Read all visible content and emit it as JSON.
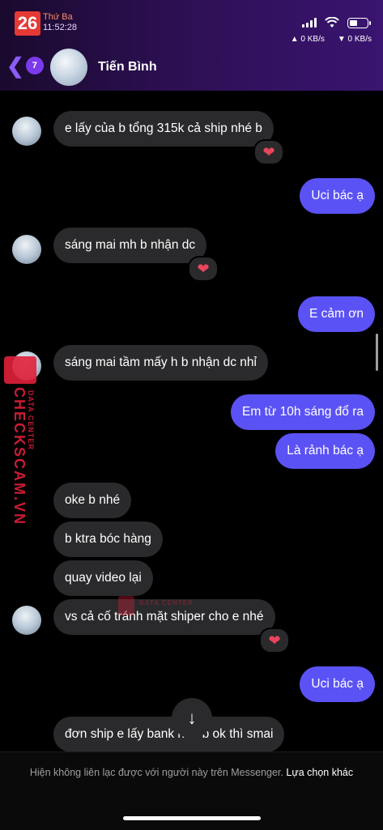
{
  "status_bar": {
    "date_number": "26",
    "weekday": "Thứ Ba",
    "time": "11:52:28",
    "upload_speed": "▲ 0 KB/s",
    "download_speed": "▼ 0 KB/s",
    "battery_level": 0.45
  },
  "header": {
    "unread_count": "7",
    "contact_name": "Tiến Bình"
  },
  "messages": [
    {
      "from": "them",
      "text": "e lấy của b tổng 315k cả ship nhé b",
      "reaction": "heart"
    },
    {
      "from": "me",
      "text": "Uci bác ạ"
    },
    {
      "from": "them",
      "text": "sáng mai mh b nhận dc",
      "reaction": "heart"
    },
    {
      "from": "me",
      "text": "E cảm ơn"
    },
    {
      "from": "them",
      "text": "sáng mai tầm mấy h b nhận dc nhỉ"
    },
    {
      "from": "me",
      "text": "Em từ 10h sáng đổ ra"
    },
    {
      "from": "me",
      "text": "Là rảnh bác ạ"
    },
    {
      "from": "them",
      "text": "oke b nhé"
    },
    {
      "from": "them",
      "text": "b ktra bóc hàng"
    },
    {
      "from": "them",
      "text": "quay video lại"
    },
    {
      "from": "them",
      "text": "vs cả cố tránh mặt shiper cho e nhé",
      "reaction": "heart"
    },
    {
      "from": "me",
      "text": "Uci bác ạ"
    },
    {
      "from": "them",
      "text": "đơn ship e lấy bank    nhé b ok thì smai"
    }
  ],
  "reaction_glyph": "❤",
  "scroll_down_icon": "↓",
  "footer": {
    "notice": "Hiện không liên lạc được với người này trên Messenger.",
    "link": "Lựa chọn khác"
  },
  "watermark": {
    "side_main": "CHECKSCAM.VN",
    "side_sub": "DATA CENTER",
    "center": "DATA CENTER"
  },
  "colors": {
    "outgoing_bubble": "#5b52f5",
    "incoming_bubble": "#2a2a2c",
    "accent": "#7c3aed",
    "reaction": "#e8455c"
  }
}
